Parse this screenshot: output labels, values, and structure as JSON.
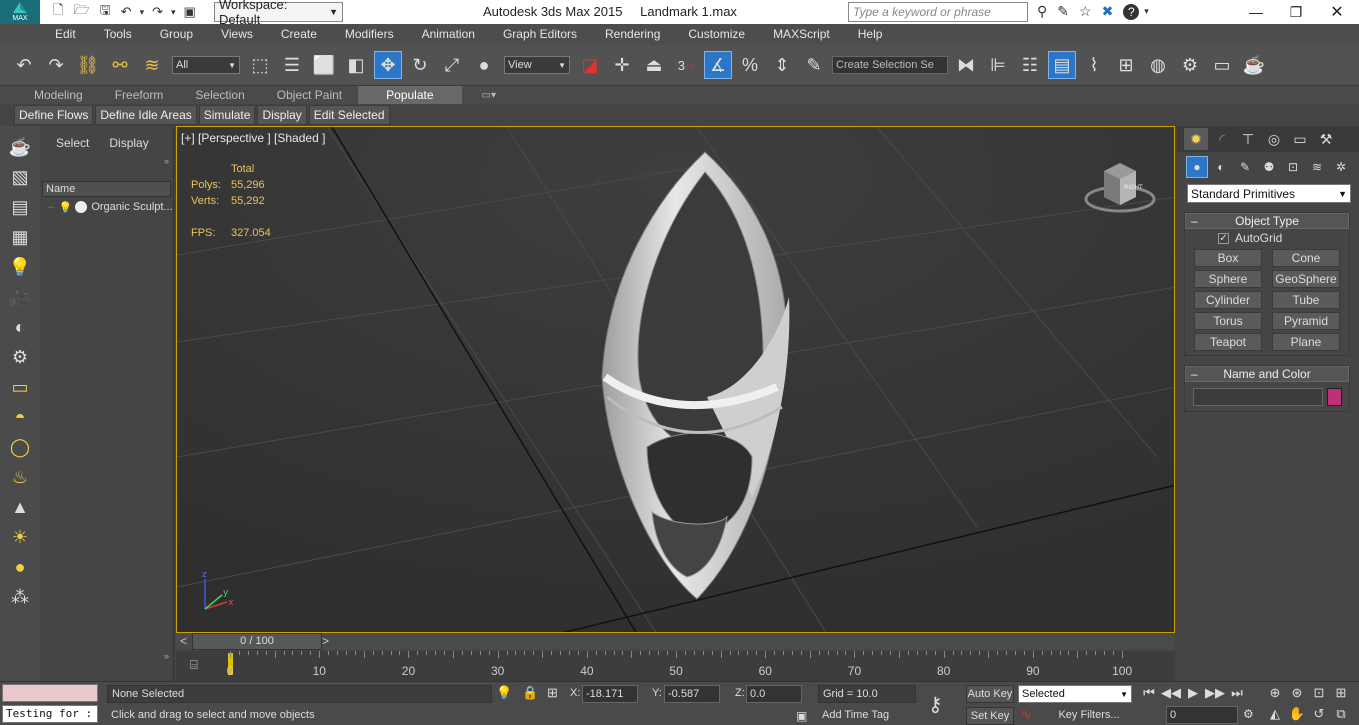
{
  "titlebar": {
    "app_title": "Autodesk 3ds Max  2015",
    "file_name": "Landmark 1.max",
    "workspace_label": "Workspace: Default",
    "search_placeholder": "Type a keyword or phrase",
    "max_label": "MAX"
  },
  "menu": {
    "items": [
      "Edit",
      "Tools",
      "Group",
      "Views",
      "Create",
      "Modifiers",
      "Animation",
      "Graph Editors",
      "Rendering",
      "Customize",
      "MAXScript",
      "Help"
    ]
  },
  "toolbar": {
    "selection_filter": "All",
    "ref_coord": "View",
    "selection_set_placeholder": "Create Selection Se",
    "snap_label": "3"
  },
  "ribbon": {
    "tabs": [
      "Modeling",
      "Freeform",
      "Selection",
      "Object Paint",
      "Populate"
    ],
    "active_tab": "Populate",
    "sub_buttons": [
      "Define Flows",
      "Define Idle Areas",
      "Simulate",
      "Display",
      "Edit Selected"
    ]
  },
  "scene_explorer": {
    "tabs": [
      "Select",
      "Display"
    ],
    "column_header": "Name",
    "items": [
      "Organic Sculpt..."
    ]
  },
  "viewport": {
    "label": "[+] [Perspective ] [Shaded ]",
    "stats_header": "Total",
    "polys_label": "Polys:",
    "polys_value": "55,296",
    "verts_label": "Verts:",
    "verts_value": "55,292",
    "fps_label": "FPS:",
    "fps_value": "327.054",
    "viewcube_label": "RIGHT"
  },
  "timeline": {
    "frame_display": "0 / 100",
    "ticks": [
      "0",
      "10",
      "20",
      "30",
      "40",
      "50",
      "60",
      "70",
      "80",
      "90",
      "100"
    ]
  },
  "command_panel": {
    "category": "Standard Primitives",
    "object_type_title": "Object Type",
    "autogrid_label": "AutoGrid",
    "buttons": [
      "Box",
      "Cone",
      "Sphere",
      "GeoSphere",
      "Cylinder",
      "Tube",
      "Torus",
      "Pyramid",
      "Teapot",
      "Plane"
    ],
    "name_color_title": "Name and Color",
    "object_name": "",
    "object_color": "#c0307a"
  },
  "status": {
    "listener_text": "Testing for :",
    "selection_text": "None Selected",
    "prompt_text": "Click and drag to select and move objects",
    "x_label": "X:",
    "x_value": "-18.171",
    "y_label": "Y:",
    "y_value": "-0.587",
    "z_label": "Z:",
    "z_value": "0.0",
    "grid_text": "Grid = 10.0",
    "add_time_tag": "Add Time Tag",
    "auto_key": "Auto Key",
    "set_key": "Set Key",
    "key_mode": "Selected",
    "key_filters": "Key Filters...",
    "current_frame": "0"
  }
}
